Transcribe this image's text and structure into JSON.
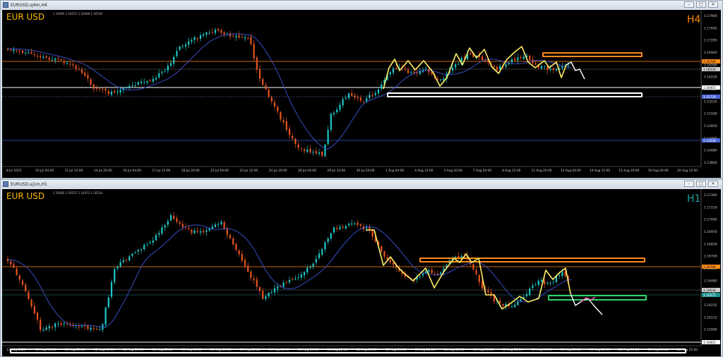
{
  "windows": [
    {
      "title": "EURUSD,sj4m,H4",
      "symbol": "EUR USD",
      "timeframe": "H4",
      "ohlc": "1.16495 1.16537 1.16469 1.16534",
      "price_scale": [
        "1.17900",
        "1.17645",
        "1.17295",
        "1.16940",
        "1.16586",
        "1.16230",
        "1.15880",
        "1.15510",
        "1.15160",
        "1.14810",
        "1.14460",
        "1.14080",
        "1.13840"
      ],
      "price_tags": {
        "orange": "1.16746",
        "grey": "1.16534",
        "white": "1.16001",
        "blue": "1.15728",
        "blue2": "1.14508"
      },
      "time_axis": [
        "8 Jul 2025",
        "10 Jul 04:00",
        "11 Jul 12:00",
        "14 Jul 20:00",
        "16 Jul 04:00",
        "17 Jul 12:00",
        "18 Jul 20:00",
        "22 Jul 04:00",
        "23 Jul 12:00",
        "24 Jul 20:00",
        "28 Jul 04:00",
        "29 Jul 12:00",
        "30 Jul 20:00",
        "1 Aug 04:00",
        "4 Aug 12:00",
        "5 Aug 20:00",
        "7 Aug 04:00",
        "8 Aug 12:00",
        "11 Aug 20:00",
        "13 Aug 04:00",
        "14 Aug 12:00",
        "15 Aug 20:00",
        "19 Aug 04:00",
        "20 Aug 12:00"
      ]
    },
    {
      "title": "EURUSD,sj1m,H1",
      "symbol": "EUR USD",
      "timeframe": "H1",
      "ohlc": "1.16482 1.16537 1.16472 1.16534",
      "price_scale": [
        "1.17390",
        "1.17210",
        "1.17095",
        "1.16970",
        "1.16830",
        "1.16700",
        "1.16600",
        "1.16480",
        "1.16360",
        "1.16235",
        "1.16115",
        "1.15990",
        "1.15870"
      ],
      "price_tags": {
        "orange": "1.16746",
        "grey": "1.16534",
        "teal": "1.16475",
        "white": "1.16001"
      },
      "time_axis": [
        "11 Aug 2025",
        "11 Aug 14:00",
        "11 Aug 22:00",
        "12 Aug 06:00",
        "12 Aug 14:00",
        "12 Aug 22:00",
        "13 Aug 06:00",
        "13 Aug 14:00",
        "13 Aug 22:00",
        "14 Aug 06:00",
        "14 Aug 14:00",
        "14 Aug 22:00",
        "15 Aug 06:00",
        "15 Aug 14:00",
        "15 Aug 22:00",
        "18 Aug 06:00",
        "18 Aug 14:00",
        "18 Aug 22:00",
        "19 Aug 06:00",
        "19 Aug 14:00",
        "19 Aug 22:00",
        "20 Aug 06:00",
        "20 Aug 14:00",
        "20 Aug 22:00"
      ]
    }
  ],
  "colors": {
    "bull": "#1ec8c8",
    "bear": "#e8541e",
    "ma": "#3c55d8",
    "zigzag": "#ffef66",
    "orange": "#ff8a1a",
    "white": "#ffffff",
    "green": "#2fd36a",
    "pink": "#ff4fc0",
    "bg": "#000000",
    "symbol": "#ffb800",
    "tf_h4": "#ff8c00",
    "tf_h1": "#19a0a0"
  },
  "icons": {
    "window_icon": "chart-window-icon",
    "minimize": "minimize-icon",
    "maximize": "maximize-icon",
    "close": "close-icon"
  }
}
